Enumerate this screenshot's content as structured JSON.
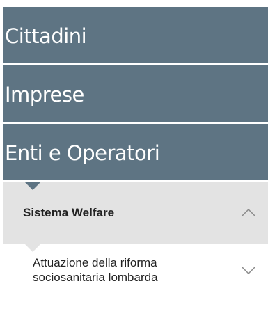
{
  "nav": {
    "main_items": [
      {
        "label": "Cittadini"
      },
      {
        "label": "Imprese"
      },
      {
        "label": "Enti e Operatori"
      }
    ],
    "submenu": {
      "label": "Sistema Welfare",
      "toggle_icon": "chevron-up-icon",
      "expanded": true,
      "children": [
        {
          "label": "Attuazione della riforma\nsociosanitaria lombarda",
          "toggle_icon": "chevron-down-icon"
        }
      ]
    }
  },
  "colors": {
    "primary": "#5e7483",
    "submenu_bg": "#e3e3e3",
    "text_dark": "#222222",
    "chevron": "#8a8a8a"
  }
}
